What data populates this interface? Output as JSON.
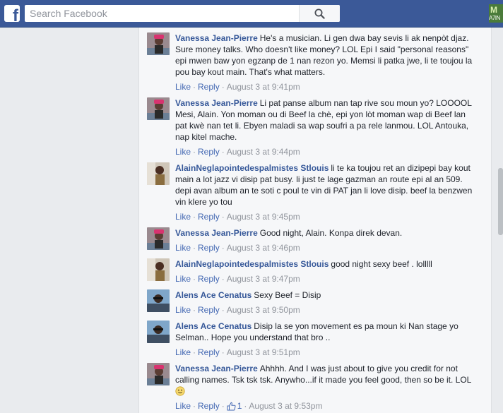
{
  "search": {
    "placeholder": "Search Facebook"
  },
  "corner_thumbnail": {
    "text_top": "M",
    "text_bottom": "A7IN"
  },
  "actions": {
    "like_label": "Like",
    "reply_label": "Reply"
  },
  "comments": [
    {
      "author": "Vanessa Jean-Pierre",
      "text": "He's a musician. Li gen dwa bay sevis li ak nenpòt djaz. Sure money talks. Who doesn't like money? LOL Epi I said \"personal reasons\" epi mwen baw yon egzanp de 1 nan rezon yo. Memsi li patka jwe, li te toujou la pou bay kout main. That's what matters.",
      "time": "August 3 at 9:41pm"
    },
    {
      "author": "Vanessa Jean-Pierre",
      "text": "Li pat panse album nan tap rive sou moun yo? LOOOOL Mesi, Alain. Yon moman ou di Beef la chè, epi yon lòt moman wap di Beef lan pat kwè nan tet li. Ebyen maladi sa wap soufri a pa rele lanmou. LOL Antouka, nap kitel mache.",
      "time": "August 3 at 9:44pm"
    },
    {
      "author": "AlainNeglapointedespalmistes Stlouis",
      "text": "li te ka toujou ret an dizipepi bay kout main a lot jazz vi disip pat busy. li just te lage gazman an route epi al an 509. depi avan album an te soti c poul te vin di PAT jan li love disip. beef la benzwen vin klere yo tou",
      "time": "August 3 at 9:45pm"
    },
    {
      "author": "Vanessa Jean-Pierre",
      "text": "Good night, Alain. Konpa direk devan.",
      "time": "August 3 at 9:46pm"
    },
    {
      "author": "AlainNeglapointedespalmistes Stlouis",
      "text": "good night sexy beef . lolllll",
      "time": "August 3 at 9:47pm"
    },
    {
      "author": "Alens Ace Cenatus",
      "text": "Sexy Beef = Disip",
      "time": "August 3 at 9:50pm"
    },
    {
      "author": "Alens Ace Cenatus",
      "text": "Disip la se yon movement es pa moun ki Nan stage yo Selman.. Hope you understand that bro ..",
      "time": "August 3 at 9:51pm"
    },
    {
      "author": "Vanessa Jean-Pierre",
      "text": "Ahhhh. And I was just about to give you credit for not calling names. Tsk tsk tsk. Anywho...if it made you feel good, then so be it. LOL",
      "time": "August 3 at 9:53pm",
      "like_count": "1",
      "emoji": "smiley-emoji"
    }
  ]
}
